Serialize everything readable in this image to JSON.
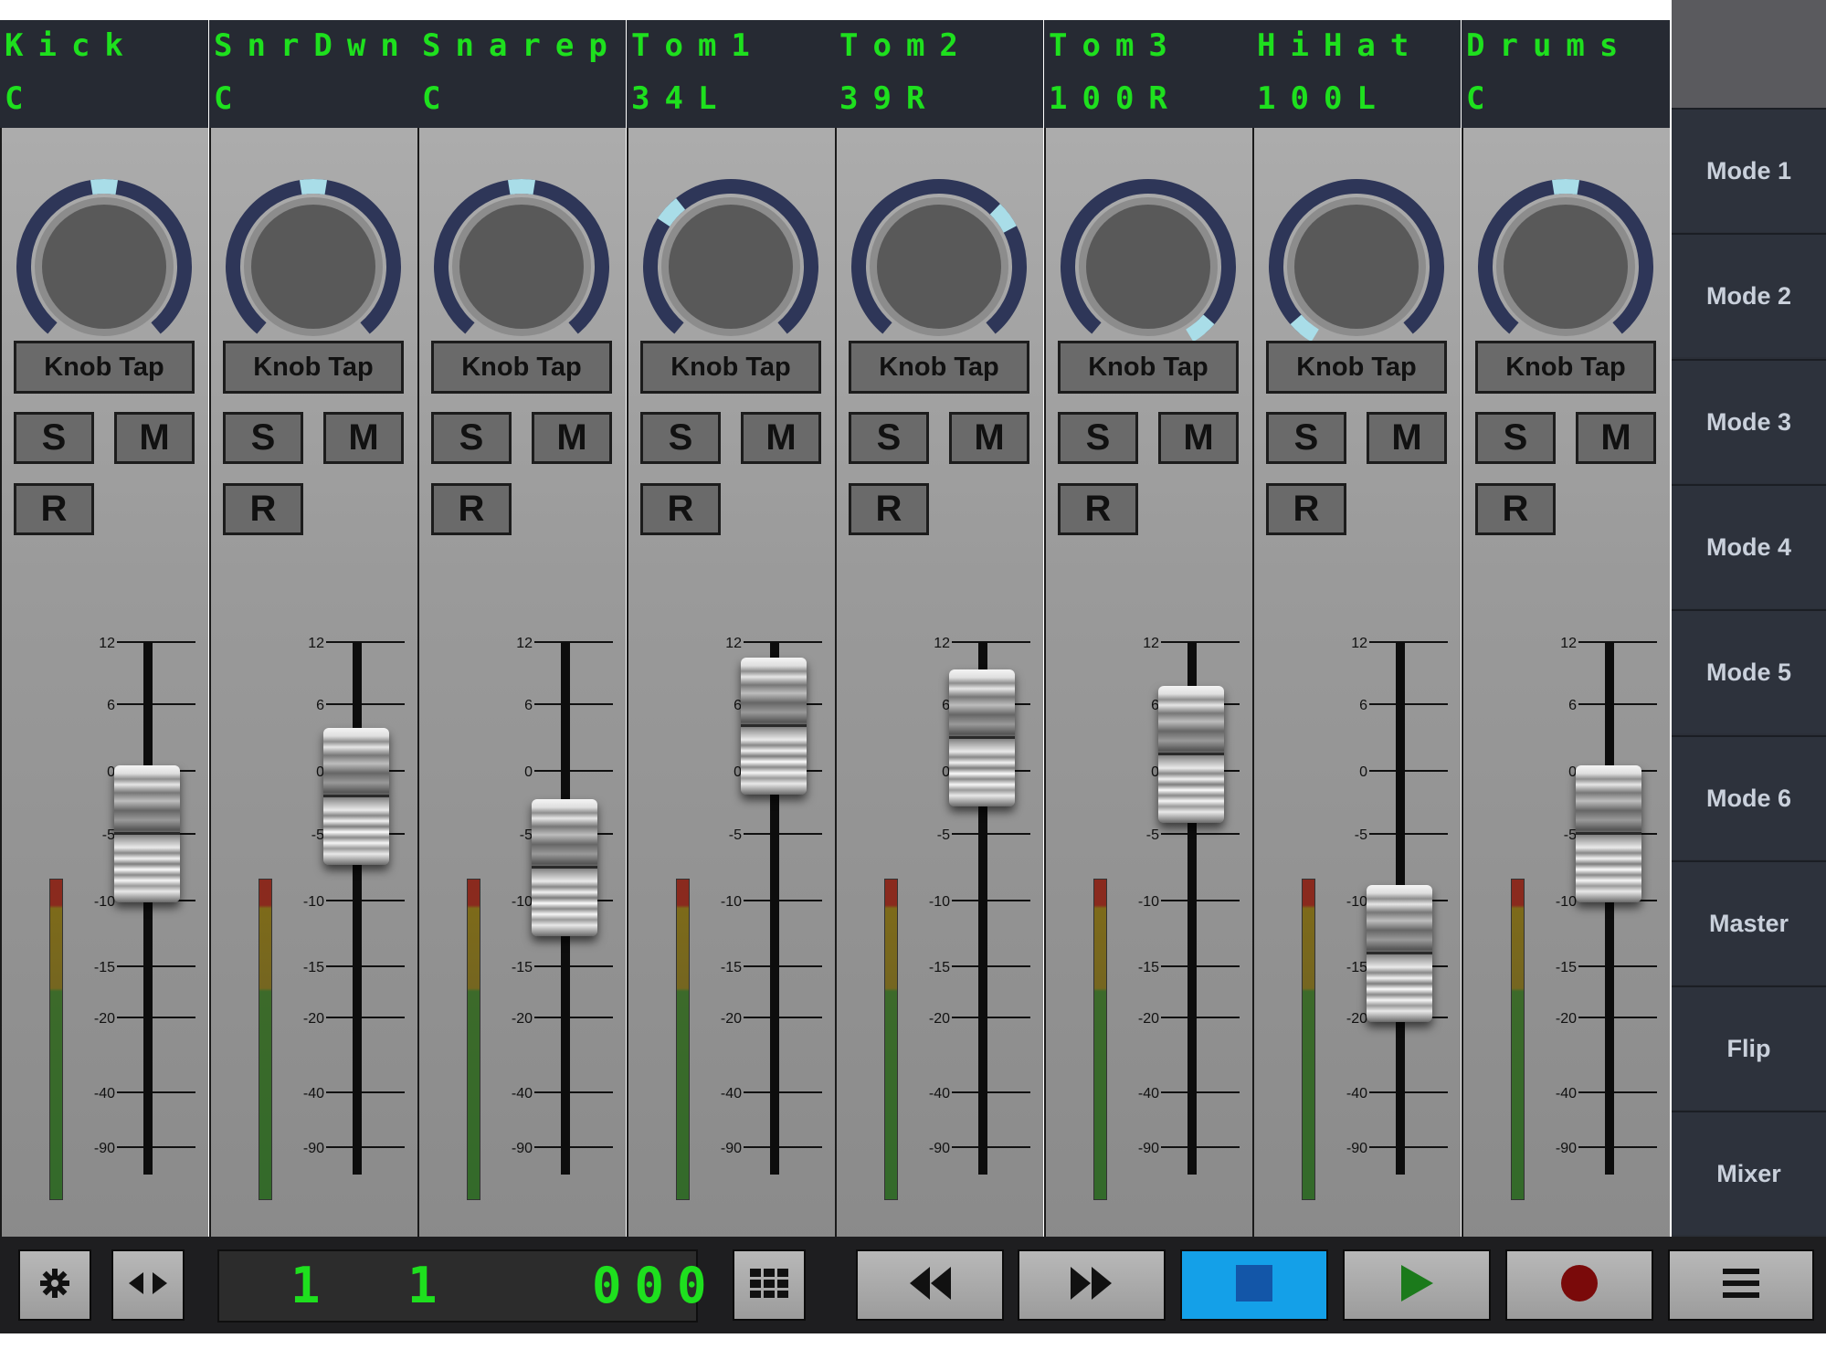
{
  "channels": [
    {
      "name": "Kick",
      "pan": "C",
      "knob_level": 0.5,
      "fader_db": -5
    },
    {
      "name": "SnrDwn",
      "pan": "C",
      "knob_level": 0.5,
      "fader_db": -2
    },
    {
      "name": "Snarep",
      "pan": "C",
      "knob_level": 0.5,
      "fader_db": -7.5
    },
    {
      "name": "Tom1",
      "pan": "34L",
      "knob_level": 0.33,
      "fader_db": 4
    },
    {
      "name": "Tom2",
      "pan": "39R",
      "knob_level": 0.69,
      "fader_db": 3
    },
    {
      "name": "Tom3",
      "pan": "100R",
      "knob_level": 1.0,
      "fader_db": 1.5
    },
    {
      "name": "HiHat",
      "pan": "100L",
      "knob_level": 0.0,
      "fader_db": -14
    },
    {
      "name": "Drums",
      "pan": "C",
      "knob_level": 0.5,
      "fader_db": -5
    }
  ],
  "strip_labels": {
    "knob_tap": "Knob Tap",
    "solo": "S",
    "mute": "M",
    "record": "R"
  },
  "fader_scale": [
    "12",
    "6",
    "0",
    "-5",
    "-10",
    "-15",
    "-20",
    "-40",
    "-90"
  ],
  "modes": [
    "Mode 1",
    "Mode 2",
    "Mode 3",
    "Mode 4",
    "Mode 5",
    "Mode 6",
    "Master",
    "Flip",
    "Mixer"
  ],
  "transport": {
    "counter": {
      "bar": "1",
      "beat": "1",
      "ticks": "000"
    },
    "icons": {
      "settings": "gear-icon",
      "toggle": "left-right-arrows-icon",
      "grid": "grid-icon",
      "rewind": "rewind-icon",
      "forward": "fast-forward-icon",
      "stop": "stop-icon",
      "play": "play-icon",
      "record": "record-icon",
      "menu": "hamburger-menu-icon"
    }
  },
  "colors": {
    "lcd_text": "#1ee01e",
    "knob_ring": "#2e3658",
    "knob_indicator": "#a9dde8",
    "stop_active": "#14a0e8",
    "stop_square": "#1356a8",
    "play": "#1b7a1b",
    "record": "#7a0a0a"
  }
}
